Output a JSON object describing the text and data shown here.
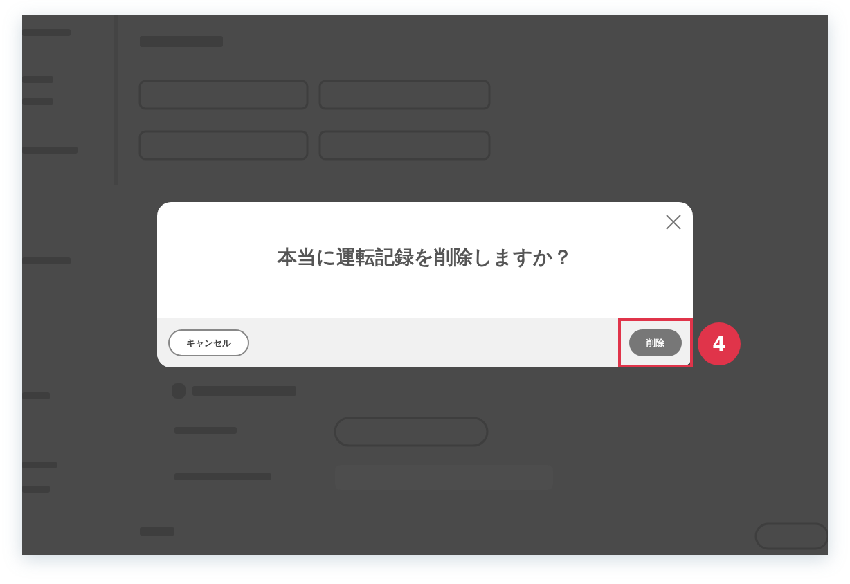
{
  "dialog": {
    "title": "本当に運転記録を削除しますか？",
    "buttons": [
      {
        "label": "キャンセル",
        "kind": "secondary",
        "highlighted": false
      },
      {
        "label": "削除",
        "kind": "primary",
        "highlighted": true
      }
    ]
  },
  "step_badge": "4"
}
